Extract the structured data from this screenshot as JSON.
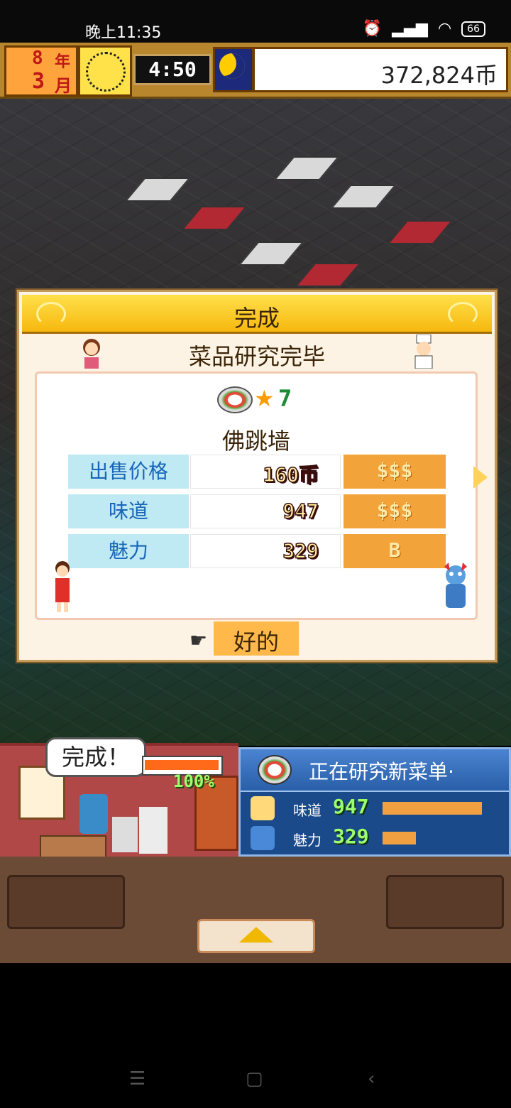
{
  "status_bar": {
    "time": "晚上11:35",
    "battery": "66"
  },
  "hud": {
    "year_value": "8",
    "year_unit": "年",
    "month_value": "3",
    "month_unit": "月",
    "game_time": "4:50",
    "coins": "372,824币"
  },
  "dialog": {
    "title": "完成",
    "subtitle": "菜品研究完毕",
    "star_level": "7",
    "dish_name": "佛跳墙",
    "rows": [
      {
        "label": "出售价格",
        "value": "160币",
        "badge": "$$$"
      },
      {
        "label": "味道",
        "value": "947",
        "badge": "$$$"
      },
      {
        "label": "魅力",
        "value": "329",
        "badge": "B"
      }
    ],
    "ok_label": "好的"
  },
  "kitchen": {
    "speech": "完成！",
    "progress_label": "100%",
    "progress_fraction": 1.0
  },
  "research": {
    "title": "正在研究新菜单·",
    "stats": [
      {
        "label": "味道",
        "value": "947",
        "fraction": 0.9
      },
      {
        "label": "魅力",
        "value": "329",
        "fraction": 0.3
      }
    ]
  },
  "colors": {
    "header_gold": "#f6b80f",
    "row_label_bg": "#bfe9f3",
    "badge_orange": "#f2a33a",
    "research_blue": "#1b4a8a"
  }
}
